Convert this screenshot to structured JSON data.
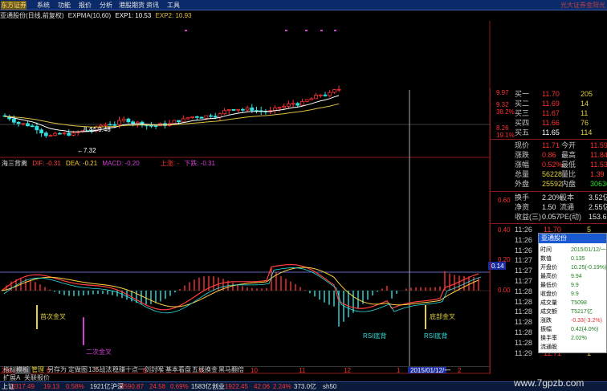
{
  "topbar": {
    "logo": "东方证券",
    "menu": [
      "系统",
      "功能",
      "报价",
      "分析",
      "港股期货",
      "资讯",
      "工具"
    ],
    "broker": "光大证券金阳光"
  },
  "info_line": {
    "stock": "亚通股份(日线,前复权)",
    "indicator": "EXPMA(10,60)",
    "exp1_label": "EXP1: 10.53",
    "exp2_label": "EXP2: 10.93"
  },
  "price_axis": [
    "9.97",
    "9.32",
    "38.2%",
    "8.26",
    "19.1%"
  ],
  "price_annotations": {
    "high_mark": "8.44-9.48",
    "low_mark": "7.32"
  },
  "indicator_header": {
    "name": "海三背离",
    "dif": "DIF: -0.31",
    "dea": "DEA: -0.21",
    "macd": "MACD: -0.20",
    "up": "上涨: -",
    "down": "下跌: -0.31"
  },
  "indicator_axis": [
    "0.60",
    "0.40",
    "0.20",
    "0.14",
    "0.00"
  ],
  "signal_labels": {
    "first": "首次金叉",
    "second": "二次金叉",
    "rsi_dev1": "RSI底背",
    "rsi_dev2": "RSI底背",
    "gold": "底部金叉"
  },
  "date_axis": [
    "2014年",
    "6",
    "7",
    "8",
    "9",
    "10",
    "11",
    "12",
    "1",
    "2015/01/12/一",
    "2"
  ],
  "tabs": [
    "指标",
    "模板",
    "管理",
    "另存为",
    "定做图",
    "135战法",
    "稳赚十点",
    "一剑封喉",
    "基本看盘",
    "五线换金",
    "黑马翻倍"
  ],
  "tabs2": [
    "扩展A",
    "关联报价"
  ],
  "status": {
    "sh_label": "上证",
    "sh_value": "3317.49",
    "sh_change": "19.13",
    "sh_pct": "0.58%",
    "sh_amount": "1921亿",
    "sz_label": "沪深",
    "sz_value": "3590.87",
    "sz_change": "24.58",
    "sz_pct": "0.69%",
    "sz_amount": "1583亿",
    "cy_label": "创业",
    "cy_value": "1922.45",
    "cy_change": "42.06",
    "cy_pct": "2.24%",
    "cy_amount": "373.0亿",
    "extra": "sh50"
  },
  "order_book": [
    {
      "label": "买一",
      "price": "11.70",
      "vol": "205"
    },
    {
      "label": "买二",
      "price": "11.69",
      "vol": "14"
    },
    {
      "label": "买三",
      "price": "11.67",
      "vol": "11"
    },
    {
      "label": "买四",
      "price": "11.66",
      "vol": "76"
    },
    {
      "label": "买五",
      "price": "11.65",
      "vol": "114"
    }
  ],
  "quote": [
    {
      "l1": "现价",
      "v1": "11.71",
      "l2": "今开",
      "v2": "11.59"
    },
    {
      "l1": "涨跌",
      "v1": "0.86",
      "l2": "最高",
      "v2": "11.84"
    },
    {
      "l1": "涨幅",
      "v1": "0.52%",
      "l2": "最低",
      "v2": "11.53"
    },
    {
      "l1": "总量",
      "v1": "56228",
      "l2": "量比",
      "v2": "1.39"
    },
    {
      "l1": "外盘",
      "v1": "25592",
      "l2": "内盘",
      "v2": "30636"
    }
  ],
  "quote2": [
    {
      "l1": "换手",
      "v1": "2.20%",
      "l2": "股本",
      "v2": "3.52亿"
    },
    {
      "l1": "净资",
      "v1": "1.50",
      "l2": "流通",
      "v2": "2.55亿"
    },
    {
      "l1": "收益(三)",
      "v1": "0.057",
      "l2": "PE(动)",
      "v2": "153.6"
    }
  ],
  "ticks": [
    {
      "time": "11:26",
      "price": "11.70",
      "vol": "5"
    },
    {
      "time": "11:26",
      "price": "",
      "vol": ""
    },
    {
      "time": "11:26",
      "price": "",
      "vol": ""
    },
    {
      "time": "11:27",
      "price": "",
      "vol": ""
    },
    {
      "time": "11:27",
      "price": "",
      "vol": ""
    },
    {
      "time": "11:27",
      "price": "",
      "vol": ""
    },
    {
      "time": "11:28",
      "price": "",
      "vol": ""
    },
    {
      "time": "11:28",
      "price": "",
      "vol": ""
    },
    {
      "time": "11:28",
      "price": "",
      "vol": ""
    },
    {
      "time": "11:28",
      "price": "",
      "vol": ""
    },
    {
      "time": "11:28",
      "price": "",
      "vol": ""
    },
    {
      "time": "11:28",
      "price": "",
      "vol": ""
    },
    {
      "time": "11:29",
      "price": "11.71",
      "vol": "1"
    }
  ],
  "popup": {
    "title": "亚通股份",
    "rows": [
      {
        "l": "时间",
        "v": "2015/01/12/一"
      },
      {
        "l": "数值",
        "v": "0.135"
      },
      {
        "l": "开盘价",
        "v": "10.25(-0.19%)"
      },
      {
        "l": "最高价",
        "v": "9.94"
      },
      {
        "l": "最低价",
        "v": "9.9"
      },
      {
        "l": "收盘价",
        "v": "9.9"
      },
      {
        "l": "成交量",
        "v": "T5098"
      },
      {
        "l": "成交额",
        "v": "T5217亿"
      },
      {
        "l": "涨跌",
        "v": "-0.33(-3.2%)"
      },
      {
        "l": "振幅",
        "v": "0.42(4.0%)"
      },
      {
        "l": "换手率",
        "v": "2.02%"
      },
      {
        "l": "流通股",
        "v": ""
      }
    ]
  },
  "bottom_price": "11.71",
  "watermark": "www.7gpzb.com",
  "colors": {
    "up": "#ff3030",
    "down": "#30e0e0",
    "exp1": "#ffffff",
    "exp2": "#e0c040",
    "dea": "#ffd040",
    "dif": "#ff4040"
  }
}
